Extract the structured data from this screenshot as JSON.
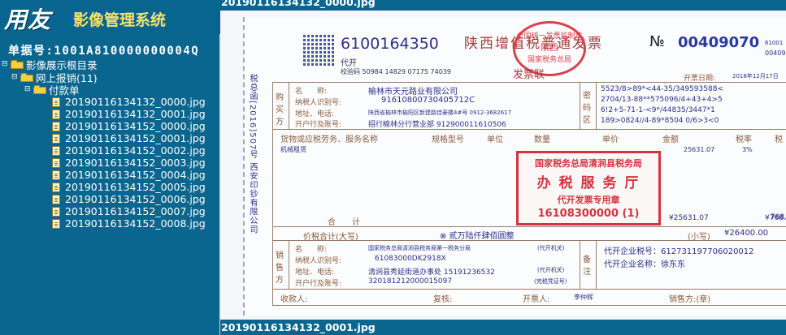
{
  "app": {
    "brand": "用友",
    "system_name": "影像管理系统"
  },
  "document_number": "单据号:1001A810000000004Q",
  "tree": {
    "root": "影像展示根目录",
    "category": "网上报销(11)",
    "subcategory": "付款单",
    "files": [
      "20190116134132_0000.jpg",
      "20190116134132_0001.jpg",
      "20190116134152_0000.jpg",
      "20190116134152_0001.jpg",
      "20190116134152_0002.jpg",
      "20190116134152_0003.jpg",
      "20190116134152_0004.jpg",
      "20190116134152_0005.jpg",
      "20190116134152_0006.jpg",
      "20190116134152_0007.jpg",
      "20190116134152_0008.jpg"
    ]
  },
  "viewer": {
    "top_image_title": "20190116134132_0000.jpg",
    "bottom_image_title": "20190116134132_0001.jpg"
  },
  "invoice": {
    "code": "6100164350",
    "title": "陕西增值税普通发票",
    "number_label": "№",
    "number": "00409070",
    "right_code_top": "61001",
    "right_code_bottom": "00409",
    "dai_kai": "代开",
    "check_code": "校验码 50984 14829 07175 74039",
    "date_label": "开票日期:",
    "date": "2018年12月17日",
    "fa_piao_lian": "发票联",
    "buyer_side": "购买方",
    "buyer_name_label": "名　　称:",
    "buyer_name": "榆林市天元路业有限公司",
    "buyer_tax_label": "纳税人识别号:",
    "buyer_tax": "91610800730405712C",
    "buyer_addr_label": "地址、电话:",
    "buyer_addr": "陕西省榆林市榆阳区新建路佳豪楼4#号 0912-3682617",
    "buyer_bank_label": "开户行及账号:",
    "buyer_bank": "招行榆林分行营业部 912900011610506",
    "pwd_label": "密码区",
    "pwd_lines": [
      "5523/8>89*<44-35/349593588<",
      "2704/13-88**575096/4+43+4>5",
      "6!2+5-71-1-<9*/44835/3447*1",
      "189>0824//4-89*8504 0/6>3<0"
    ],
    "col_goods": "货物或应税劳务、服务名称",
    "col_spec": "规格型号",
    "col_unit": "单位",
    "col_qty": "数量",
    "col_price": "单价",
    "col_amount": "金额",
    "col_rate": "税率",
    "col_tax": "税",
    "item_name": "机械租赁",
    "item_amount": "25631.07",
    "item_rate": "3%",
    "item_tax": "768.",
    "subtotal_label": "合　　计",
    "subtotal_amount": "¥25631.07",
    "subtotal_tax": "¥768.",
    "total_label": "价税合计(大写)",
    "total_words": "⊗ 贰万陆仟肆佰圆整",
    "total_small_label": "(小写)",
    "total_small": "¥26400.00",
    "seller_side": "销售方",
    "seller_name_label": "名　　称:",
    "seller_name": "国家税务总局清涧县税务局第一税务分局",
    "seller_tax_label": "纳税人识别号:",
    "seller_tax": "61083000DK2918X",
    "seller_addr_label": "地址、电话:",
    "seller_addr": "清涧县秀延街道办事处 15191236532",
    "seller_bank_label": "开户行及账号:",
    "seller_bank": "320181212000015097",
    "dk_tag1": "(代开机关)",
    "dk_tag2": "(代开机关)",
    "dk_tag3": "(完税凭证号)",
    "remark_label": "备注",
    "remark_line1": "代开企业税号：612731197706020012",
    "remark_line2": "代开企业名称：徐东东",
    "payee_label": "收款人:",
    "reviewer_label": "复核:",
    "drawer_label": "开票人:",
    "drawer": "李仲辉",
    "seller_sign_label": "销售方:(章)",
    "left_vertical": "税总函[2016]507号 西安印钞有限公司",
    "stamp_oval_lines": [
      "全国统一发票监制章",
      "陕西",
      "国家税务总局"
    ],
    "stamp_rect_lines": [
      "国家税务总局清涧县税务局",
      "办 税 服 务 厅",
      "代开发票专用章",
      "16108300000 (1)"
    ]
  },
  "colors": {
    "background": "#08658f",
    "title_yellow": "#f7e26b",
    "stamp_red": "#d63341",
    "ink_blue": "#2f2f8a"
  }
}
